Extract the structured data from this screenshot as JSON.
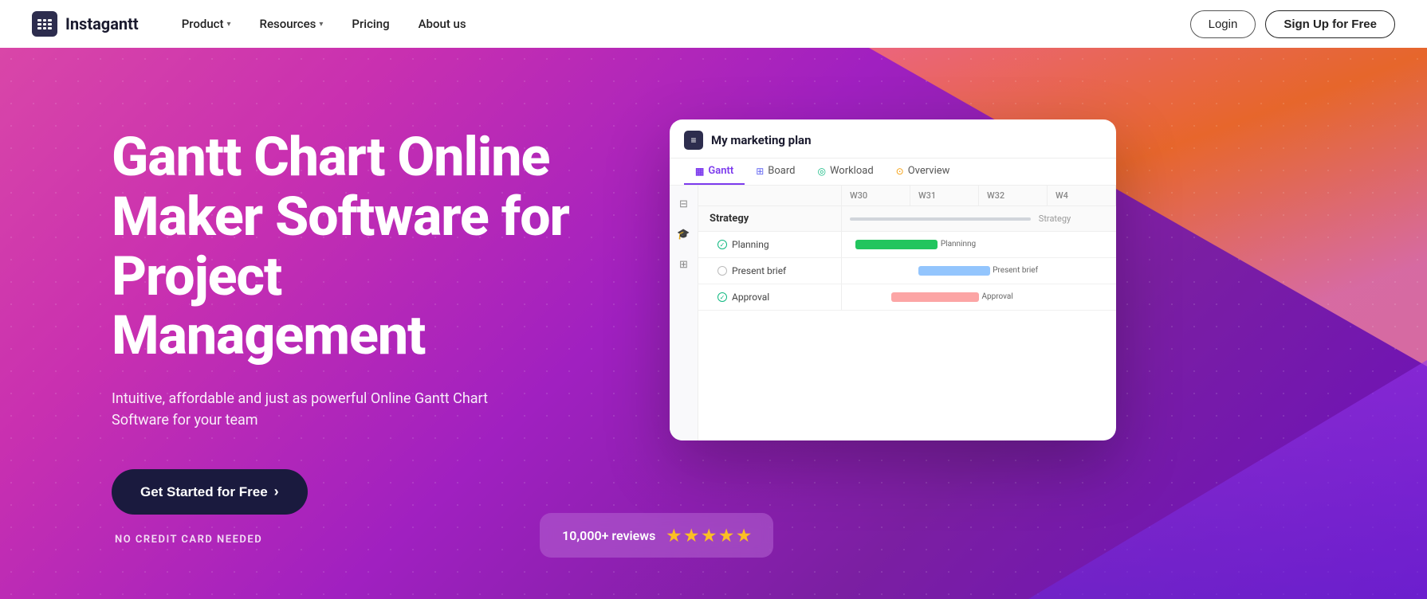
{
  "brand": {
    "name": "Instagantt",
    "logo_label": "Instagantt"
  },
  "nav": {
    "links": [
      {
        "label": "Product",
        "has_dropdown": true
      },
      {
        "label": "Resources",
        "has_dropdown": true
      },
      {
        "label": "Pricing",
        "has_dropdown": false
      },
      {
        "label": "About us",
        "has_dropdown": false
      }
    ],
    "login_label": "Login",
    "signup_label": "Sign Up for Free"
  },
  "hero": {
    "title": "Gantt Chart Online Maker Software for Project Management",
    "subtitle": "Intuitive, affordable and just as powerful Online Gantt Chart Software for your team",
    "cta_label": "Get Started for Free",
    "no_credit": "NO CREDIT CARD NEEDED",
    "reviews_count": "10,000+ reviews"
  },
  "app_window": {
    "title": "My marketing plan",
    "tabs": [
      {
        "label": "Gantt",
        "active": true,
        "dot_color": "#7c3aed"
      },
      {
        "label": "Board",
        "active": false,
        "dot_color": "#6366f1"
      },
      {
        "label": "Workload",
        "active": false,
        "dot_color": "#10b981"
      },
      {
        "label": "Overview",
        "active": false,
        "dot_color": "#f59e0b"
      }
    ],
    "weeks": [
      "W30",
      "W31",
      "W32",
      "W4"
    ],
    "group": {
      "name": "Strategy",
      "label_right": "Strategy"
    },
    "tasks": [
      {
        "name": "Planning",
        "bar_color": "#22c55e",
        "bar_left": "5%",
        "bar_width": "30%",
        "label": "Planninng",
        "label_left": "36%"
      },
      {
        "name": "Present brief",
        "bar_color": "#93c5fd",
        "bar_left": "28%",
        "bar_width": "26%",
        "label": "Present brief",
        "label_left": "55%"
      },
      {
        "name": "Approval",
        "bar_color": "#fca5a5",
        "bar_left": "18%",
        "bar_width": "32%",
        "label": "Approval",
        "label_left": "51%"
      }
    ]
  }
}
